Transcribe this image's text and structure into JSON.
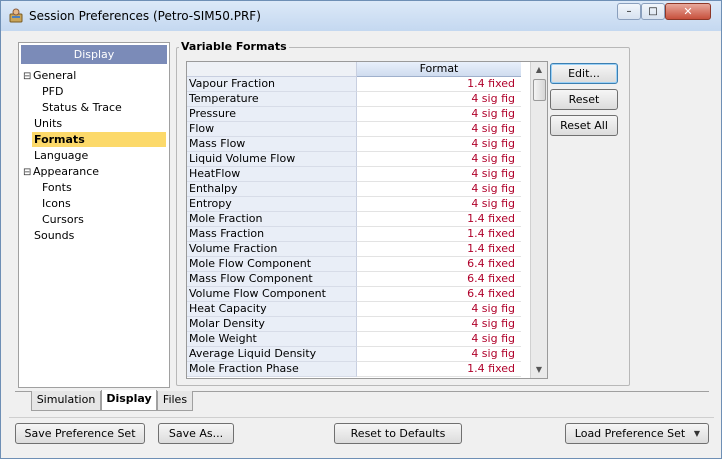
{
  "window": {
    "title": "Session Preferences (Petro-SIM50.PRF)",
    "icon": "app-preferences-icon",
    "controls": {
      "minimize": "–",
      "maximize": "□",
      "close": "✕"
    }
  },
  "tree": {
    "header": "Display",
    "items": [
      {
        "label": "General",
        "level": 0,
        "toggle": "⊟"
      },
      {
        "label": "PFD",
        "level": 1,
        "toggle": ""
      },
      {
        "label": "Status & Trace",
        "level": 1,
        "toggle": ""
      },
      {
        "label": "Units",
        "level": 0,
        "toggle": ""
      },
      {
        "label": "Formats",
        "level": 0,
        "toggle": "",
        "selected": true
      },
      {
        "label": "Language",
        "level": 0,
        "toggle": ""
      },
      {
        "label": "Appearance",
        "level": 0,
        "toggle": "⊟"
      },
      {
        "label": "Fonts",
        "level": 1,
        "toggle": ""
      },
      {
        "label": "Icons",
        "level": 1,
        "toggle": ""
      },
      {
        "label": "Cursors",
        "level": 1,
        "toggle": ""
      },
      {
        "label": "Sounds",
        "level": 0,
        "toggle": ""
      }
    ]
  },
  "variable_formats": {
    "group_title": "Variable Formats",
    "column_header": "Format",
    "rows": [
      {
        "name": "Vapour Fraction",
        "format": "1.4 fixed"
      },
      {
        "name": "Temperature",
        "format": "4 sig fig"
      },
      {
        "name": "Pressure",
        "format": "4 sig fig"
      },
      {
        "name": "Flow",
        "format": "4 sig fig"
      },
      {
        "name": "Mass Flow",
        "format": "4 sig fig"
      },
      {
        "name": "Liquid Volume Flow",
        "format": "4 sig fig"
      },
      {
        "name": "HeatFlow",
        "format": "4 sig fig"
      },
      {
        "name": "Enthalpy",
        "format": "4 sig fig"
      },
      {
        "name": "Entropy",
        "format": "4 sig fig"
      },
      {
        "name": "Mole Fraction",
        "format": "1.4 fixed"
      },
      {
        "name": "Mass Fraction",
        "format": "1.4 fixed"
      },
      {
        "name": "Volume Fraction",
        "format": "1.4 fixed"
      },
      {
        "name": "Mole Flow Component",
        "format": "6.4 fixed"
      },
      {
        "name": "Mass Flow Component",
        "format": "6.4 fixed"
      },
      {
        "name": "Volume Flow Component",
        "format": "6.4 fixed"
      },
      {
        "name": "Heat Capacity",
        "format": "4 sig fig"
      },
      {
        "name": "Molar Density",
        "format": "4 sig fig"
      },
      {
        "name": "Mole Weight",
        "format": "4 sig fig"
      },
      {
        "name": "Average Liquid Density",
        "format": "4 sig fig"
      },
      {
        "name": "Mole Fraction Phase",
        "format": "1.4 fixed"
      }
    ]
  },
  "side_buttons": {
    "edit": "Edit...",
    "reset": "Reset",
    "reset_all": "Reset All"
  },
  "tabs": [
    {
      "label": "Simulation",
      "active": false
    },
    {
      "label": "Display",
      "active": true
    },
    {
      "label": "Files",
      "active": false
    }
  ],
  "footer": {
    "save_set": "Save Preference Set",
    "save_as": "Save As...",
    "reset_defaults": "Reset to Defaults",
    "load_set": "Load Preference Set"
  },
  "colors": {
    "value_text": "#b0002a",
    "tree_header": "#7b8bb8",
    "selection": "#fcd96a"
  }
}
